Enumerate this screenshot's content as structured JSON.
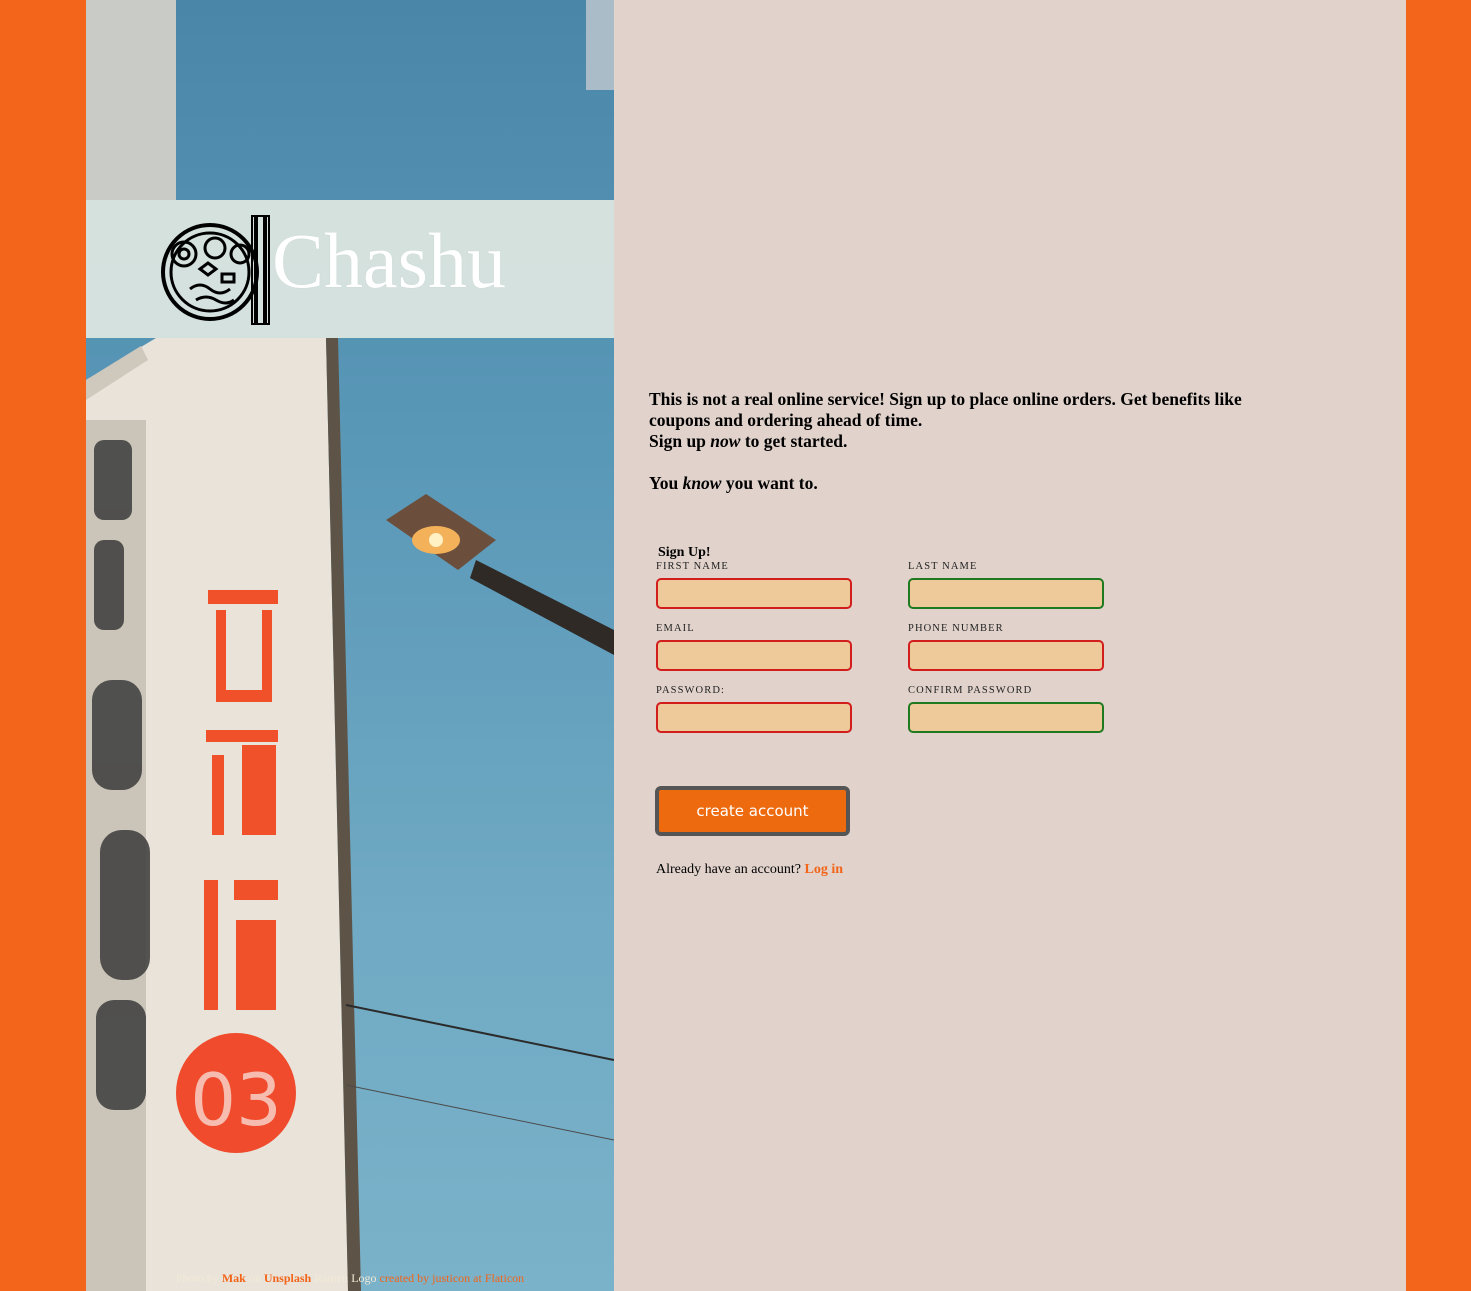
{
  "brand": {
    "name": "Chashu",
    "logo_icon": "ramen-bowl-icon"
  },
  "credits": {
    "photo_prefix": "Photo by",
    "photographer": "Mak",
    "on": "on",
    "site": "Unsplash",
    "logo_prefix": "Ramen Logo",
    "logo_credit": "created by justicon at Flaticon"
  },
  "intro": {
    "line1": "This is not a real online service! Sign up to place online orders. Get benefits like coupons and ordering ahead of time.",
    "line2_before": "Sign up ",
    "line2_em": "now",
    "line2_after": " to get started.",
    "line3_before": "You ",
    "line3_em": "know",
    "line3_after": " you want to."
  },
  "form": {
    "title": "Sign Up!",
    "fields": [
      {
        "label": "FIRST NAME",
        "value": "",
        "valid": false
      },
      {
        "label": "LAST NAME",
        "value": "",
        "valid": true
      },
      {
        "label": "EMAIL",
        "value": "",
        "valid": false
      },
      {
        "label": "PHONE NUMBER",
        "value": "",
        "valid": false
      },
      {
        "label": "PASSWORD:",
        "value": "",
        "valid": false
      },
      {
        "label": "CONFIRM PASSWORD",
        "value": "",
        "valid": true
      }
    ],
    "submit_label": "create account",
    "login_prompt": "Already have an account?",
    "login_link": "Log in"
  },
  "colors": {
    "page_background": "#f2651a",
    "panel_background": "#e1d3cc",
    "input_fill": "#eec99a",
    "invalid_border": "#d21d1d",
    "valid_border": "#1f7a1f",
    "button_fill": "#ee6a0f",
    "link": "#f2651a"
  }
}
